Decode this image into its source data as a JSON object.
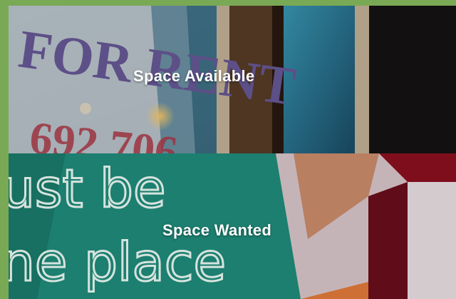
{
  "tiles": [
    {
      "label": "Space Available",
      "photo_sign_text": "FOR RENT",
      "photo_sign_phone": "692 706"
    },
    {
      "label": "Space Wanted",
      "photo_neon_line1": "ust be",
      "photo_neon_line2": "ne place"
    }
  ],
  "colors": {
    "background_green": "#7aa955",
    "label_text": "#ffffff",
    "neon_teal": "#1f8a7a",
    "sign_red": "#b23a4a"
  }
}
